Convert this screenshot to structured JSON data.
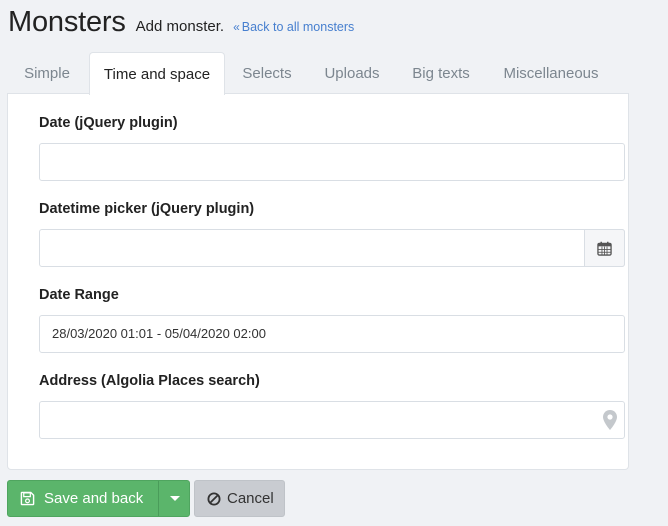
{
  "header": {
    "title": "Monsters",
    "subtitle": "Add monster.",
    "back_link": "Back to all monsters"
  },
  "tabs": [
    {
      "label": "Simple",
      "active": false
    },
    {
      "label": "Time and space",
      "active": true
    },
    {
      "label": "Selects",
      "active": false
    },
    {
      "label": "Uploads",
      "active": false
    },
    {
      "label": "Big texts",
      "active": false
    },
    {
      "label": "Miscellaneous",
      "active": false
    }
  ],
  "form": {
    "date": {
      "label": "Date (jQuery plugin)",
      "value": ""
    },
    "datetime": {
      "label": "Datetime picker (jQuery plugin)",
      "value": "",
      "icon": "calendar-icon"
    },
    "date_range": {
      "label": "Date Range",
      "value": "28/03/2020 01:01 - 05/04/2020 02:00"
    },
    "address": {
      "label": "Address (Algolia Places search)",
      "value": "",
      "icon": "map-pin-icon"
    }
  },
  "actions": {
    "save_label": "Save and back",
    "cancel_label": "Cancel"
  },
  "colors": {
    "accent_link": "#467fcf",
    "save_button": "#5bb56b",
    "cancel_button": "#c9ccd1"
  }
}
